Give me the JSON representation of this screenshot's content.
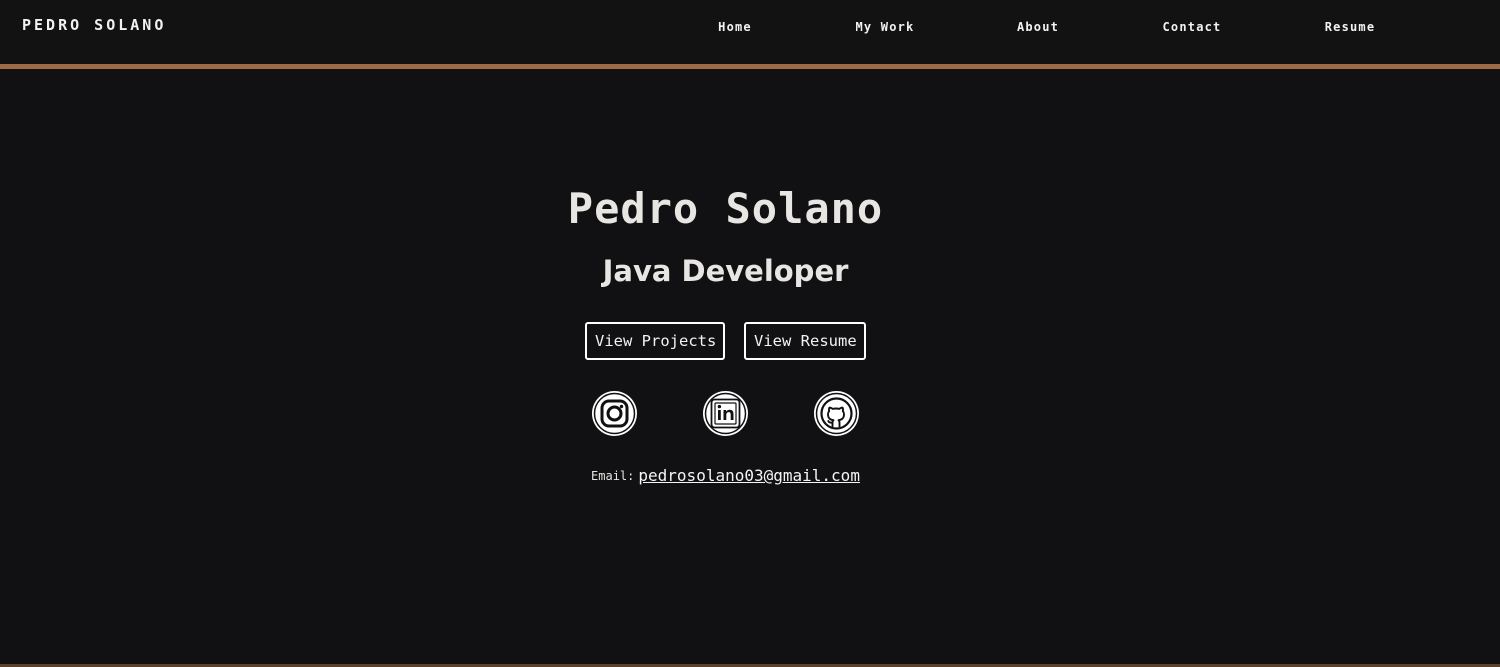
{
  "nav": {
    "brand": "PEDRO SOLANO",
    "links": [
      "Home",
      "My Work",
      "About",
      "Contact",
      "Resume"
    ]
  },
  "hero": {
    "name": "Pedro Solano",
    "role": "Java Developer",
    "buttons": {
      "projects": "View Projects",
      "resume": "View Resume"
    },
    "social": [
      "instagram-icon",
      "linkedin-icon",
      "github-icon"
    ],
    "email_label": "Email:",
    "email": "pedrosolano03@gmail.com"
  },
  "colors": {
    "background": "#111113",
    "accent": "#9a6b45",
    "text": "#e8e6e3"
  }
}
